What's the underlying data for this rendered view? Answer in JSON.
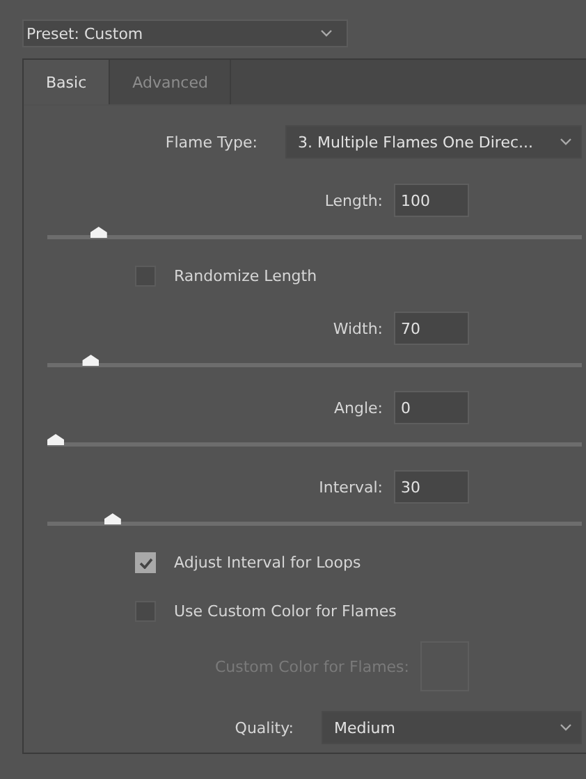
{
  "preset": {
    "value": "Preset: Custom"
  },
  "tabs": [
    {
      "label": "Basic",
      "selected": true
    },
    {
      "label": "Advanced",
      "selected": false
    }
  ],
  "controls": [
    {
      "kind": "select",
      "label": "Flame Type:",
      "value": "3. Multiple Flames One Direc..."
    },
    {
      "kind": "number",
      "label": "Length:",
      "value": "100",
      "level": 0.083
    },
    {
      "kind": "checkbox",
      "label": "Randomize Length",
      "checked": false
    },
    {
      "kind": "number",
      "label": "Width:",
      "value": "70",
      "level": 0.068
    },
    {
      "kind": "number",
      "label": "Angle:",
      "value": "0",
      "level": 0
    },
    {
      "kind": "number",
      "label": "Interval:",
      "value": "30",
      "level": 0.11
    },
    {
      "kind": "checkbox",
      "label": "Adjust Interval for Loops",
      "checked": true
    },
    {
      "kind": "checkbox",
      "label": "Use Custom Color for Flames",
      "checked": false
    },
    {
      "kind": "color",
      "label": "Custom Color for Flames:",
      "disabled": true
    },
    {
      "kind": "select",
      "label": "Quality:",
      "value": "Medium"
    }
  ]
}
